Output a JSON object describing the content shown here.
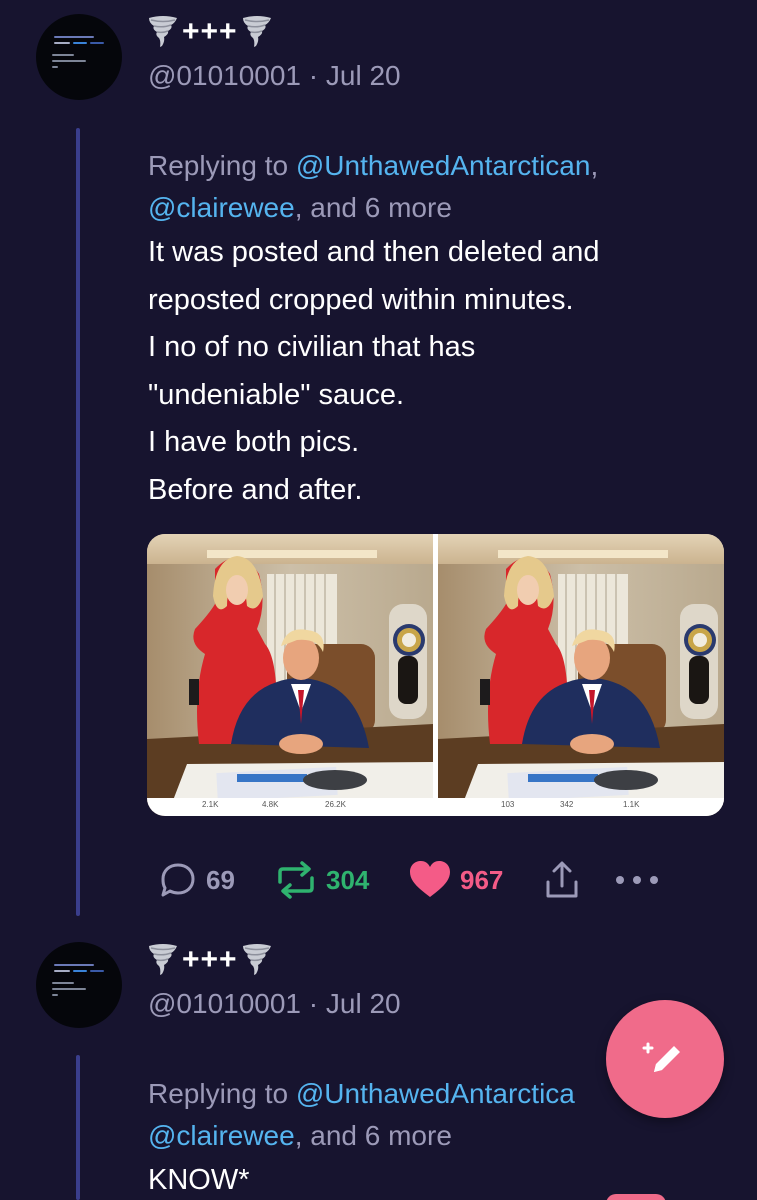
{
  "tweets": [
    {
      "display_name": "+++",
      "handle": "@01010001",
      "separator": "·",
      "date": "Jul 20",
      "replying_prefix": "Replying to",
      "reply_mention_1": "@UnthawedAntarctican",
      "reply_comma": ",",
      "reply_mention_2": "@clairewee",
      "reply_suffix": ", and 6 more",
      "body_lines": [
        "It was posted and then deleted and",
        "reposted cropped within minutes.",
        "I no of no civilian that has",
        "\"undeniable\" sauce.",
        "I have both pics.",
        "Before and after."
      ],
      "media": {
        "left_counts": [
          "2.1K",
          "4.8K",
          "26.2K"
        ],
        "right_counts": [
          "103",
          "342",
          "1.1K"
        ]
      },
      "stats": {
        "replies": "69",
        "retweets": "304",
        "likes": "967"
      }
    },
    {
      "display_name": "+++",
      "handle": "@01010001",
      "separator": "·",
      "date": "Jul 20",
      "replying_prefix": "Replying to",
      "reply_mention_1": "@UnthawedAntarctica",
      "reply_mention_2": "@clairewee",
      "reply_suffix": ", and 6 more",
      "body_lines": [
        "KNOW*"
      ]
    }
  ],
  "colors": {
    "background": "#17142f",
    "mention": "#55b4ef",
    "muted": "#9c9ab8",
    "retweet": "#2fb36f",
    "like": "#f45b87",
    "fab": "#f06b8a",
    "thread_line": "#3a3e8c"
  },
  "icons": {
    "reply": "speech-bubble-icon",
    "retweet": "retweet-arrows-icon",
    "like": "heart-icon",
    "share": "share-icon",
    "more": "more-dots-icon",
    "compose": "compose-feather-icon",
    "emoji": "tornado-emoji"
  }
}
